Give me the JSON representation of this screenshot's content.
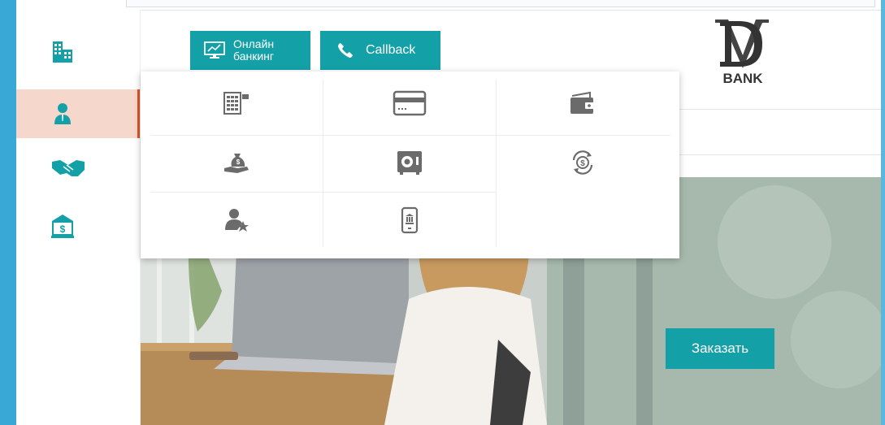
{
  "header": {
    "online_banking_label": "Онлайн банкинг",
    "online_banking_line1": "Онлайн",
    "online_banking_line2": "банкинг",
    "callback_label": "Callback",
    "logo_text": "BANK"
  },
  "sidenav": {
    "items": [
      {
        "icon": "building-icon",
        "active": false
      },
      {
        "icon": "person-icon",
        "active": true
      },
      {
        "icon": "handshake-icon",
        "active": false
      },
      {
        "icon": "bank-icon",
        "active": false
      }
    ]
  },
  "dropdown": {
    "items": [
      {
        "icon": "calculator-icon"
      },
      {
        "icon": "credit-card-icon"
      },
      {
        "icon": "wallet-icon"
      },
      {
        "icon": "money-bag-hand-icon"
      },
      {
        "icon": "safe-icon"
      },
      {
        "icon": "currency-exchange-icon"
      },
      {
        "icon": "person-star-icon"
      },
      {
        "icon": "mobile-bank-icon"
      }
    ]
  },
  "hero": {
    "order_label": "Заказать"
  },
  "colors": {
    "accent": "#14a0a7",
    "active_bg": "#f5d7cb",
    "active_border": "#d9552b",
    "icon_gray": "#6b6b6b",
    "slide_bg": "#3aa8d6"
  }
}
